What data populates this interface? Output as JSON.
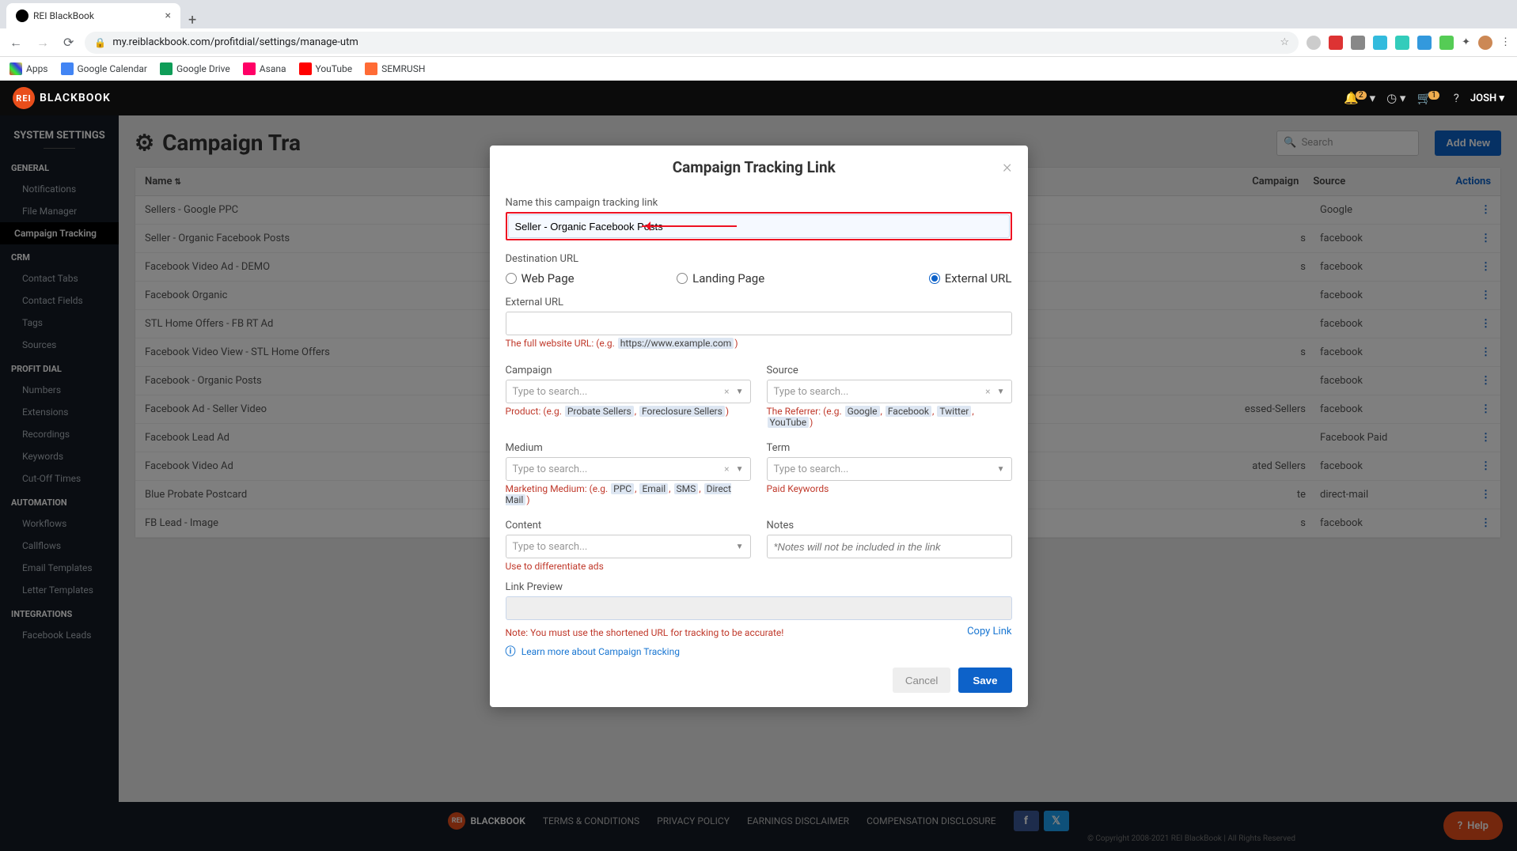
{
  "browser": {
    "tab_title": "REI BlackBook",
    "url": "my.reiblackbook.com/profitdial/settings/manage-utm",
    "bookmarks": [
      "Apps",
      "Google Calendar",
      "Google Drive",
      "Asana",
      "YouTube",
      "SEMRUSH"
    ]
  },
  "header": {
    "brand_badge": "REI",
    "brand_text": "BLACKBOOK",
    "bell_count": "2",
    "cart_count": "1",
    "user": "JOSH"
  },
  "sidebar": {
    "title": "SYSTEM SETTINGS",
    "sections": [
      {
        "label": "GENERAL",
        "items": [
          "Notifications",
          "File Manager",
          "Campaign Tracking"
        ]
      },
      {
        "label": "CRM",
        "items": [
          "Contact Tabs",
          "Contact Fields",
          "Tags",
          "Sources"
        ]
      },
      {
        "label": "PROFIT DIAL",
        "items": [
          "Numbers",
          "Extensions",
          "Recordings",
          "Keywords",
          "Cut-Off Times"
        ]
      },
      {
        "label": "AUTOMATION",
        "items": [
          "Workflows",
          "Callflows",
          "Email Templates",
          "Letter Templates"
        ]
      },
      {
        "label": "INTEGRATIONS",
        "items": [
          "Facebook Leads"
        ]
      }
    ],
    "active": "Campaign Tracking"
  },
  "page": {
    "title": "Campaign Tra",
    "search_placeholder": "Search",
    "add_button": "Add New",
    "columns": {
      "name": "Name",
      "campaign": "Campaign",
      "source": "Source",
      "actions": "Actions"
    },
    "rows": [
      {
        "name": "Sellers - Google PPC",
        "campaign": "",
        "source": "Google"
      },
      {
        "name": "Seller - Organic Facebook Posts",
        "campaign": "s",
        "source": "facebook"
      },
      {
        "name": "Facebook Video Ad - DEMO",
        "campaign": "s",
        "source": "facebook"
      },
      {
        "name": "Facebook Organic",
        "campaign": "",
        "source": "facebook"
      },
      {
        "name": "STL Home Offers - FB RT Ad",
        "campaign": "",
        "source": "facebook"
      },
      {
        "name": "Facebook Video View - STL Home Offers",
        "campaign": "s",
        "source": "facebook"
      },
      {
        "name": "Facebook - Organic Posts",
        "campaign": "",
        "source": "facebook"
      },
      {
        "name": "Facebook Ad - Seller Video",
        "campaign": "essed-Sellers",
        "source": "facebook"
      },
      {
        "name": "Facebook Lead Ad",
        "campaign": "",
        "source": "Facebook Paid"
      },
      {
        "name": "Facebook Video Ad",
        "campaign": "ated Sellers",
        "source": "facebook"
      },
      {
        "name": "Blue Probate Postcard",
        "campaign": "te",
        "source": "direct-mail"
      },
      {
        "name": "FB Lead - Image",
        "campaign": "s",
        "source": "facebook"
      }
    ]
  },
  "modal": {
    "title": "Campaign Tracking Link",
    "name_label": "Name this campaign tracking link",
    "name_value": "Seller - Organic Facebook Posts",
    "dest_label": "Destination URL",
    "radios": {
      "web": "Web Page",
      "landing": "Landing Page",
      "external": "External URL"
    },
    "exturl_label": "External URL",
    "exturl_hint_prefix": "The full website URL: (e.g.",
    "exturl_hint_ex": "https://www.example.com",
    "campaign_label": "Campaign",
    "campaign_placeholder": "Type to search...",
    "campaign_hint_prefix": "Product: (e.g.",
    "campaign_hint_ex1": "Probate Sellers",
    "campaign_hint_ex2": "Foreclosure Sellers",
    "source_label": "Source",
    "source_placeholder": "Type to search...",
    "source_hint_prefix": "The Referrer: (e.g.",
    "source_hint_ex1": "Google",
    "source_hint_ex2": "Facebook",
    "source_hint_ex3": "Twitter",
    "source_hint_ex4": "YouTube",
    "medium_label": "Medium",
    "medium_placeholder": "Type to search...",
    "medium_hint_prefix": "Marketing Medium: (e.g.",
    "medium_hint_ex1": "PPC",
    "medium_hint_ex2": "Email",
    "medium_hint_ex3": "SMS",
    "medium_hint_ex4": "Direct Mail",
    "term_label": "Term",
    "term_placeholder": "Type to search...",
    "term_hint": "Paid Keywords",
    "content_label": "Content",
    "content_placeholder": "Type to search...",
    "content_hint": "Use to differentiate ads",
    "notes_label": "Notes",
    "notes_placeholder": "*Notes will not be included in the link",
    "preview_label": "Link Preview",
    "preview_hint": "Note: You must use the shortened URL for tracking to be accurate!",
    "copy_link": "Copy Link",
    "learn_more": "Learn more about Campaign Tracking",
    "cancel": "Cancel",
    "save": "Save"
  },
  "footer": {
    "links": [
      "TERMS & CONDITIONS",
      "PRIVACY POLICY",
      "EARNINGS DISCLAIMER",
      "COMPENSATION DISCLOSURE"
    ],
    "copyright": "© Copyright 2008-2021 REI BlackBook | All Rights Reserved",
    "help": "Help"
  }
}
